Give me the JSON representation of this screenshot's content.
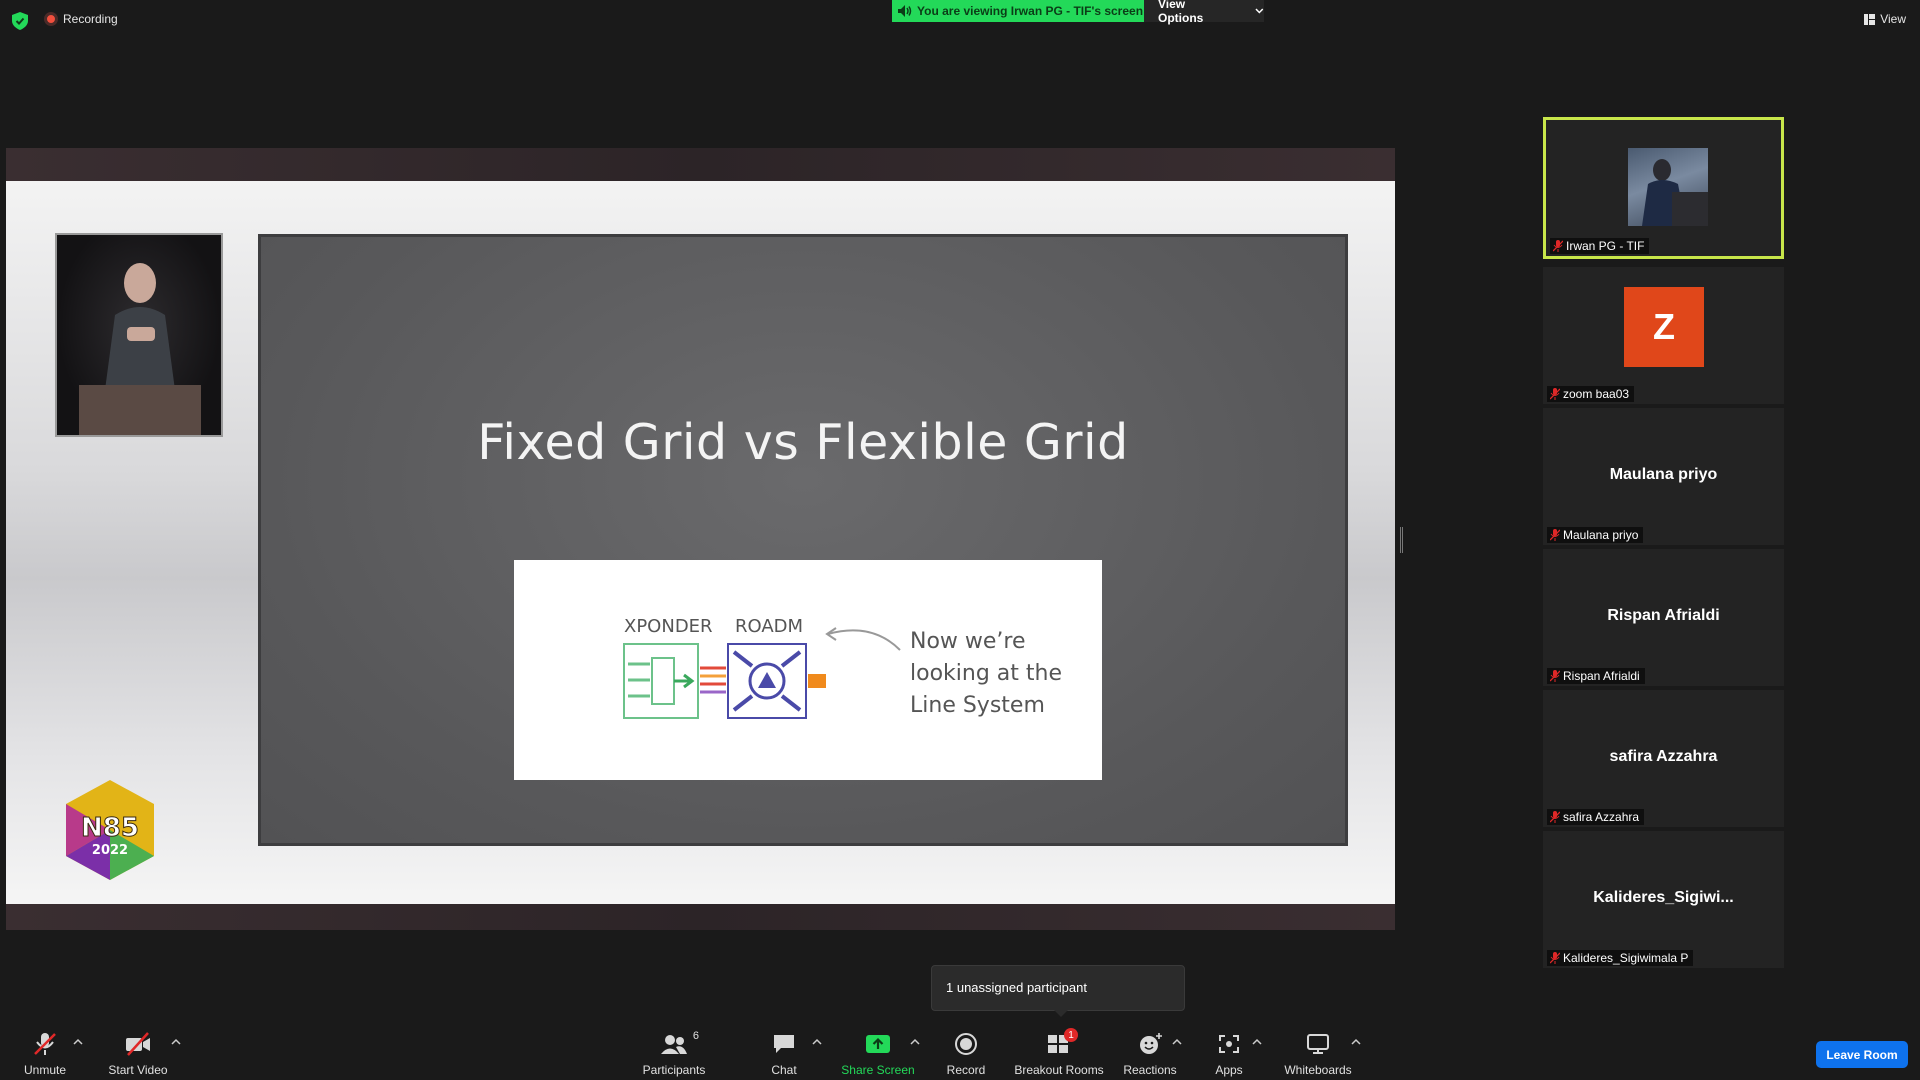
{
  "top": {
    "recording_label": "Recording",
    "viewing_banner": "You are viewing Irwan PG - TIF's screen",
    "view_options_label": "View Options",
    "view_label": "View"
  },
  "slide": {
    "title": "Fixed Grid vs Flexible Grid",
    "xponder_label": "XPONDER",
    "roadm_label": "ROADM",
    "note_lines": [
      "Now we’re",
      "looking at the",
      "Line System"
    ],
    "logo_text": "N85",
    "logo_year": "2022"
  },
  "gallery": [
    {
      "name": "Irwan PG - TIF",
      "type": "video",
      "active": true
    },
    {
      "name": "zoom baa03",
      "type": "avatar",
      "initial": "Z"
    },
    {
      "name": "Maulana priyo",
      "type": "name",
      "center_name": "Maulana priyo"
    },
    {
      "name": "Rispan Afrialdi",
      "type": "name",
      "center_name": "Rispan Afrialdi"
    },
    {
      "name": "safira Azzahra",
      "type": "name",
      "center_name": "safira Azzahra"
    },
    {
      "name": "Kalideres_Sigiwimala P",
      "type": "name",
      "center_name": "Kalideres_Sigiwi..."
    }
  ],
  "tooltip": "1 unassigned participant",
  "toolbar": {
    "unmute": "Unmute",
    "start_video": "Start Video",
    "participants": "Participants",
    "participants_count": "6",
    "chat": "Chat",
    "share_screen": "Share Screen",
    "record": "Record",
    "breakout_rooms": "Breakout Rooms",
    "breakout_badge": "1",
    "reactions": "Reactions",
    "apps": "Apps",
    "whiteboards": "Whiteboards",
    "leave_room": "Leave Room"
  },
  "colors": {
    "accent_green": "#23d959",
    "active_border": "#c8e64a",
    "leave_blue": "#0e72ed",
    "mute_red": "#e02828",
    "avatar_orange": "#e0471a"
  }
}
